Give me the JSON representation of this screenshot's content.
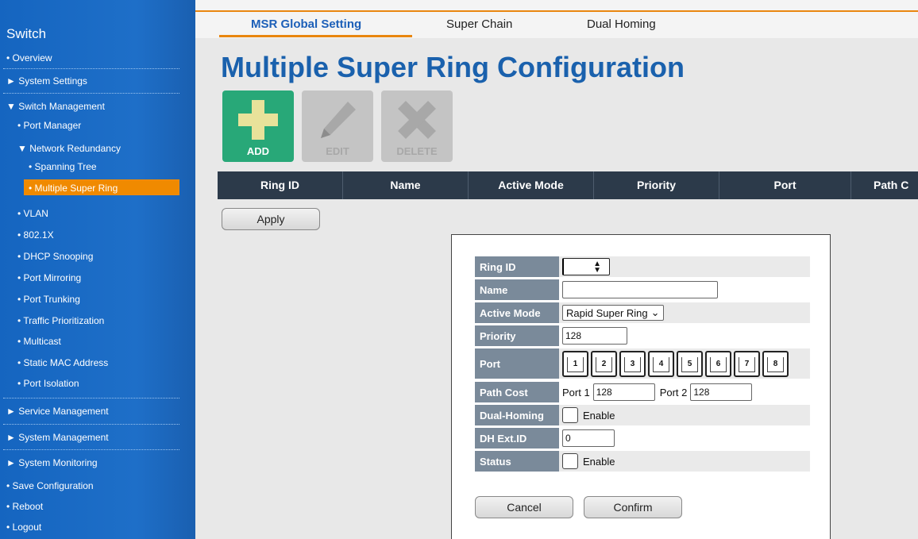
{
  "sidebar": {
    "title": "Switch",
    "items": [
      {
        "label": "• Overview"
      },
      {
        "label": "► System Settings"
      },
      {
        "label": "▼ Switch Management"
      },
      {
        "label": "• Port Manager"
      },
      {
        "label": "▼ Network Redundancy"
      },
      {
        "label": "• Spanning Tree"
      },
      {
        "label": "• Multiple Super Ring"
      },
      {
        "label": "• VLAN"
      },
      {
        "label": "• 802.1X"
      },
      {
        "label": "• DHCP Snooping"
      },
      {
        "label": "• Port Mirroring"
      },
      {
        "label": "• Port Trunking"
      },
      {
        "label": "• Traffic Prioritization"
      },
      {
        "label": "• Multicast"
      },
      {
        "label": "• Static MAC Address"
      },
      {
        "label": "• Port Isolation"
      },
      {
        "label": "► Service Management"
      },
      {
        "label": "► System Management"
      },
      {
        "label": "► System Monitoring"
      },
      {
        "label": "• Save Configuration"
      },
      {
        "label": "• Reboot"
      },
      {
        "label": "• Logout"
      }
    ]
  },
  "tabs": [
    "MSR Global Setting",
    "Super Chain",
    "Dual Homing"
  ],
  "page_title": "Multiple Super Ring Configuration",
  "toolbar": {
    "add": "ADD",
    "edit": "EDIT",
    "delete": "DELETE"
  },
  "table": {
    "headers": [
      "Ring ID",
      "Name",
      "Active Mode",
      "Priority",
      "Port",
      "Path C"
    ]
  },
  "apply_label": "Apply",
  "form": {
    "ring_id_label": "Ring ID",
    "name_label": "Name",
    "name_value": "",
    "active_mode_label": "Active Mode",
    "active_mode_value": "Rapid Super Ring",
    "priority_label": "Priority",
    "priority_value": "128",
    "port_label": "Port",
    "ports": [
      "1",
      "2",
      "3",
      "4",
      "5",
      "6",
      "7",
      "8"
    ],
    "path_cost_label": "Path Cost",
    "port1_label": "Port 1",
    "port1_value": "128",
    "port2_label": "Port 2",
    "port2_value": "128",
    "dual_homing_label": "Dual-Homing",
    "dual_homing_enable": "Enable",
    "dh_ext_id_label": "DH Ext.ID",
    "dh_ext_id_value": "0",
    "status_label": "Status",
    "status_enable": "Enable"
  },
  "dialog": {
    "cancel": "Cancel",
    "confirm": "Confirm"
  },
  "colors": {
    "accent_orange": "#e9860f",
    "sidebar_blue": "#1565c0",
    "title_blue": "#1a61ad",
    "add_green": "#28a878",
    "header_dark": "#2c3a4a"
  }
}
